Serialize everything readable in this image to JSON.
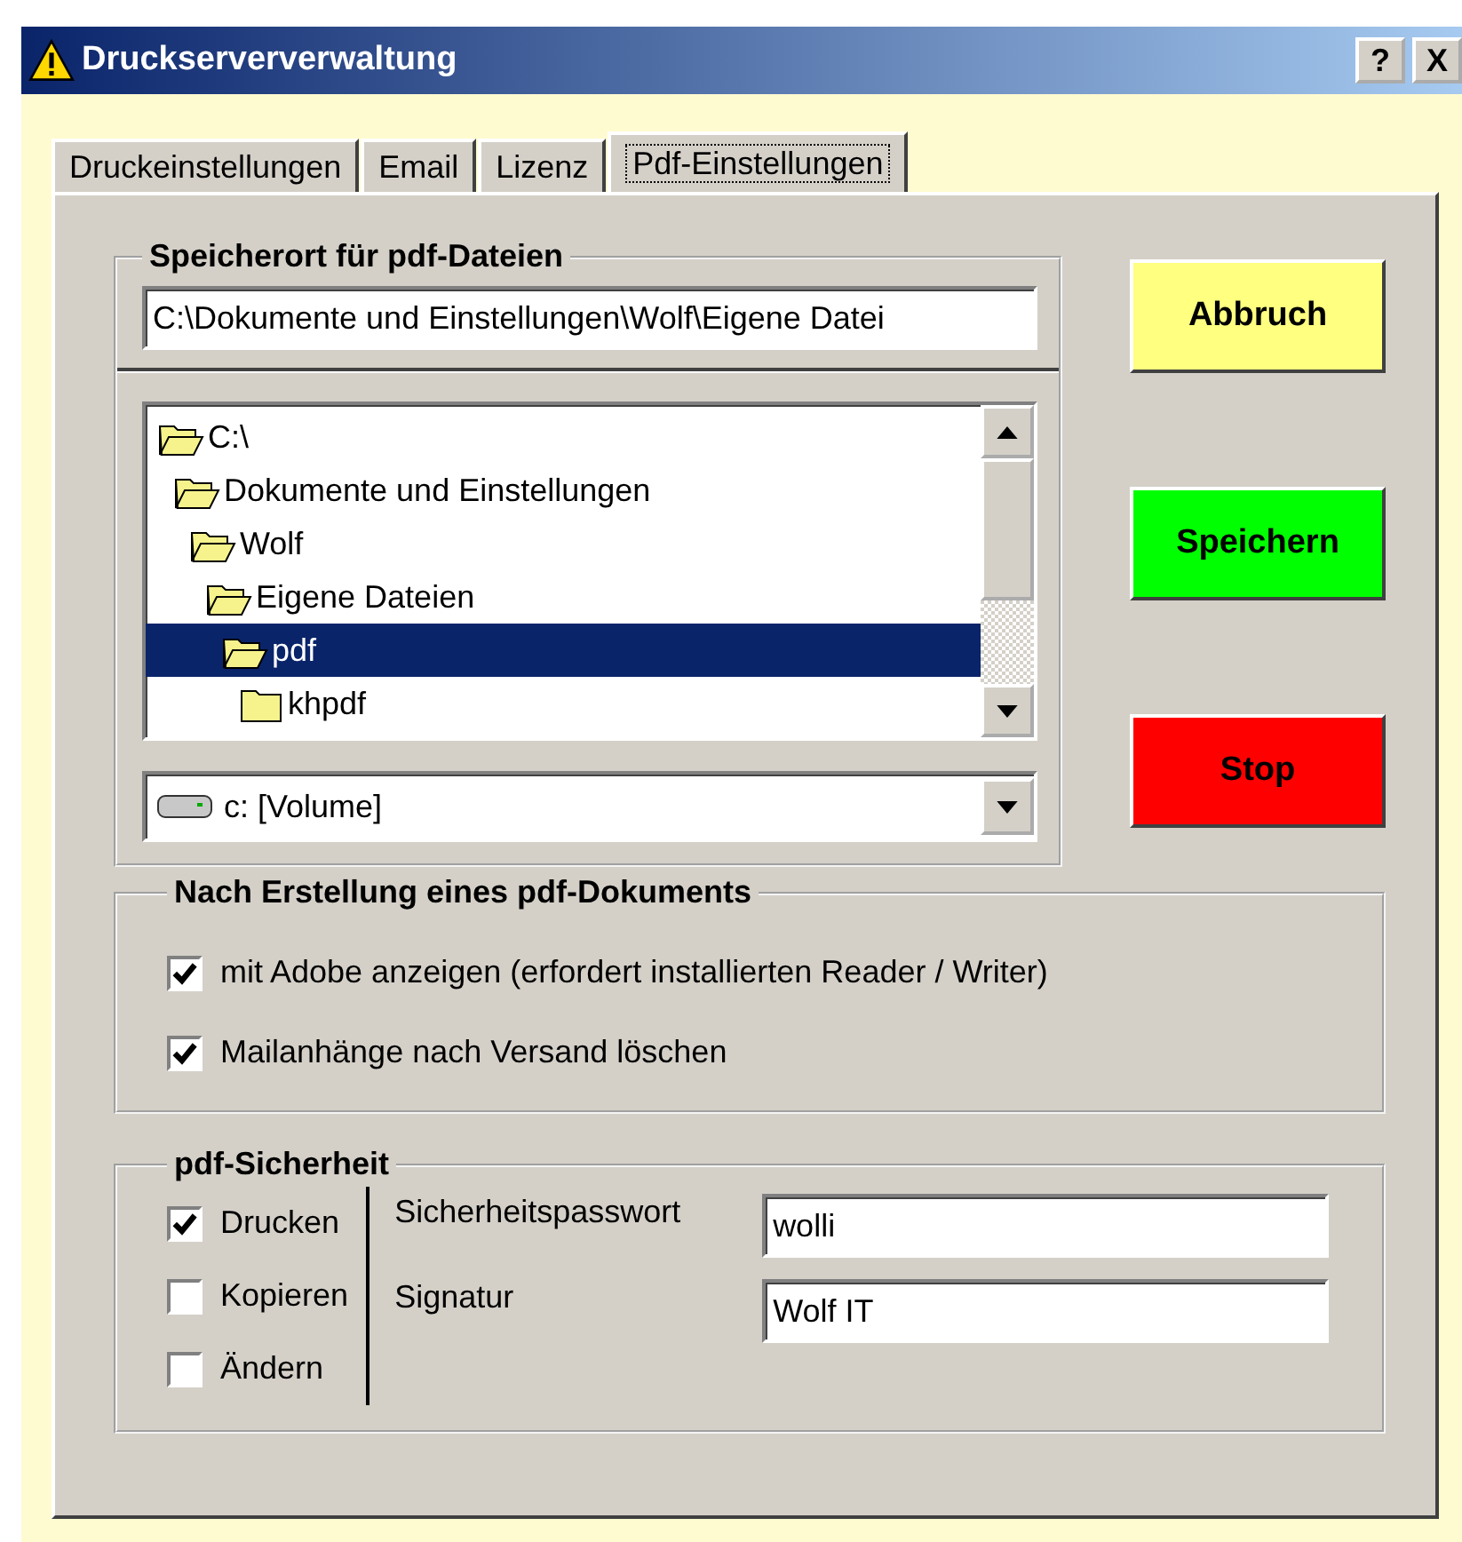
{
  "window": {
    "title": "Druckserververwaltung",
    "help_button": "?",
    "close_button": "X"
  },
  "tabs": [
    {
      "label": "Druckeinstellungen",
      "selected": false
    },
    {
      "label": "Email",
      "selected": false
    },
    {
      "label": "Lizenz",
      "selected": false
    },
    {
      "label": "Pdf-Einstellungen",
      "selected": true
    }
  ],
  "storage": {
    "title": "Speicherort für pdf-Dateien",
    "path": "C:\\Dokumente und Einstellungen\\Wolf\\Eigene Datei",
    "tree": [
      {
        "label": "C:\\",
        "open": true,
        "selected": false,
        "children": [
          {
            "label": "Dokumente und Einstellungen",
            "open": true,
            "selected": false,
            "children": [
              {
                "label": "Wolf",
                "open": true,
                "selected": false,
                "children": [
                  {
                    "label": "Eigene Dateien",
                    "open": true,
                    "selected": false,
                    "children": [
                      {
                        "label": "pdf",
                        "open": true,
                        "selected": true,
                        "children": [
                          {
                            "label": "khpdf",
                            "open": false,
                            "selected": false
                          }
                        ]
                      }
                    ]
                  }
                ]
              }
            ]
          }
        ]
      }
    ],
    "drive": "c: [Volume]"
  },
  "actions": [
    {
      "label": "Abbruch",
      "color": "#ffff80"
    },
    {
      "label": "Speichern",
      "color": "#00ff00"
    },
    {
      "label": "Stop",
      "color": "#ff0000"
    }
  ],
  "after_creation": {
    "title": "Nach Erstellung eines pdf-Dokuments",
    "options": [
      {
        "label": "mit Adobe anzeigen (erfordert installierten Reader / Writer)",
        "checked": true
      },
      {
        "label": "Mailanhänge nach Versand löschen",
        "checked": true
      }
    ]
  },
  "security": {
    "title": "pdf-Sicherheit",
    "permissions": [
      {
        "label": "Drucken",
        "checked": true
      },
      {
        "label": "Kopieren",
        "checked": false
      },
      {
        "label": "Ändern",
        "checked": false
      }
    ],
    "fields": [
      {
        "label": "Sicherheitspasswort",
        "value": "wolli"
      },
      {
        "label": "Signatur",
        "value": "Wolf IT"
      }
    ]
  }
}
